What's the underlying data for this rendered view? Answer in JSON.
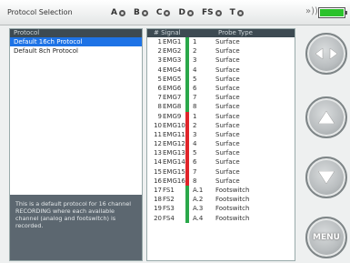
{
  "header": {
    "title": "Protocol Selection",
    "channels": [
      "A",
      "B",
      "C",
      "D",
      "FS",
      "T"
    ],
    "wifi": "»))"
  },
  "left_panel": {
    "header": "Protocol",
    "items": [
      {
        "label": "Default 16ch Protocol",
        "selected": true
      },
      {
        "label": "Default 8ch Protocol",
        "selected": false
      }
    ],
    "description": "This is a default protocol for 16 channel RECORDING where each available channel (analog and footswitch) is recorded."
  },
  "table": {
    "headers": {
      "signal": "# Signal",
      "position": "Probe",
      "type": "Type"
    },
    "rows": [
      {
        "num": "1",
        "signal": "EMG1",
        "pos": "1",
        "type": "Surface",
        "bar_color": "#2aa84a"
      },
      {
        "num": "2",
        "signal": "EMG2",
        "pos": "2",
        "type": "Surface",
        "bar_color": "#2aa84a"
      },
      {
        "num": "3",
        "signal": "EMG3",
        "pos": "3",
        "type": "Surface",
        "bar_color": "#2aa84a"
      },
      {
        "num": "4",
        "signal": "EMG4",
        "pos": "4",
        "type": "Surface",
        "bar_color": "#2aa84a"
      },
      {
        "num": "5",
        "signal": "EMG5",
        "pos": "5",
        "type": "Surface",
        "bar_color": "#2aa84a"
      },
      {
        "num": "6",
        "signal": "EMG6",
        "pos": "6",
        "type": "Surface",
        "bar_color": "#2aa84a"
      },
      {
        "num": "7",
        "signal": "EMG7",
        "pos": "7",
        "type": "Surface",
        "bar_color": "#2aa84a"
      },
      {
        "num": "8",
        "signal": "EMG8",
        "pos": "8",
        "type": "Surface",
        "bar_color": "#2aa84a"
      },
      {
        "num": "9",
        "signal": "EMG9",
        "pos": "1",
        "type": "Surface",
        "bar_color": "#e0242a"
      },
      {
        "num": "10",
        "signal": "EMG10",
        "pos": "2",
        "type": "Surface",
        "bar_color": "#e0242a"
      },
      {
        "num": "11",
        "signal": "EMG11",
        "pos": "3",
        "type": "Surface",
        "bar_color": "#e0242a"
      },
      {
        "num": "12",
        "signal": "EMG12",
        "pos": "4",
        "type": "Surface",
        "bar_color": "#e0242a"
      },
      {
        "num": "13",
        "signal": "EMG13",
        "pos": "5",
        "type": "Surface",
        "bar_color": "#e0242a"
      },
      {
        "num": "14",
        "signal": "EMG14",
        "pos": "6",
        "type": "Surface",
        "bar_color": "#e0242a"
      },
      {
        "num": "15",
        "signal": "EMG15",
        "pos": "7",
        "type": "Surface",
        "bar_color": "#e0242a"
      },
      {
        "num": "16",
        "signal": "EMG16",
        "pos": "8",
        "type": "Surface",
        "bar_color": "#e0242a"
      },
      {
        "num": "17",
        "signal": "FS1",
        "pos": "A.1",
        "type": "Footswitch",
        "bar_color": "#2aa84a"
      },
      {
        "num": "18",
        "signal": "FS2",
        "pos": "A.2",
        "type": "Footswitch",
        "bar_color": "#2aa84a"
      },
      {
        "num": "19",
        "signal": "FS3",
        "pos": "A.3",
        "type": "Footswitch",
        "bar_color": "#2aa84a"
      },
      {
        "num": "20",
        "signal": "FS4",
        "pos": "A.4",
        "type": "Footswitch",
        "bar_color": "#2aa84a"
      }
    ]
  },
  "buttons": {
    "back": "back-arrows-icon",
    "up": "arrow-up-icon",
    "down": "arrow-down-icon",
    "menu": "MENU"
  },
  "battery": {
    "level": 1.0,
    "color": "#2bc22b"
  }
}
